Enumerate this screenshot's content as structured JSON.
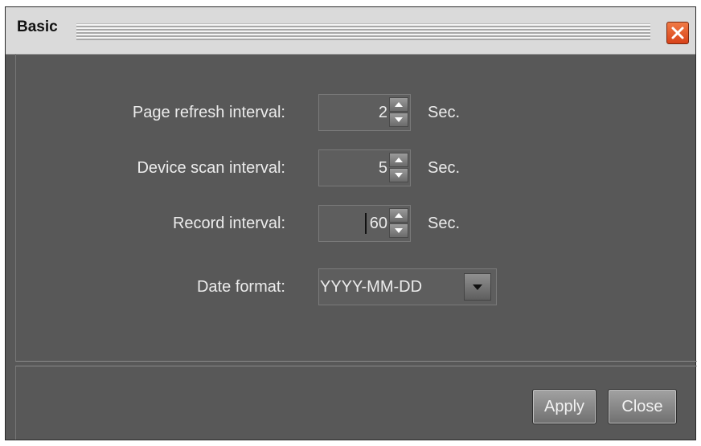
{
  "window": {
    "title": "Basic",
    "close_icon": "close-icon"
  },
  "form": {
    "page_refresh": {
      "label": "Page refresh interval:",
      "value": "2",
      "unit": "Sec."
    },
    "device_scan": {
      "label": "Device scan interval:",
      "value": "5",
      "unit": "Sec."
    },
    "record": {
      "label": "Record interval:",
      "value": "60",
      "unit": "Sec."
    },
    "date_format": {
      "label": "Date format:",
      "value": "YYYY-MM-DD"
    }
  },
  "buttons": {
    "apply": "Apply",
    "close": "Close"
  },
  "colors": {
    "panel_bg": "#585858",
    "titlebar_bg": "#dadada",
    "close_accent": "#e0582a"
  }
}
